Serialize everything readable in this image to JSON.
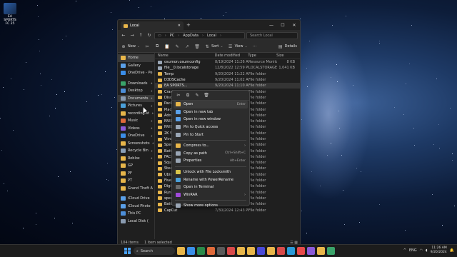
{
  "desktop": {
    "icon_label": "EA SPORTS FC 25"
  },
  "window": {
    "tab_title": "Local",
    "close_tab": "✕",
    "new_tab": "+",
    "controls": {
      "minimize": "—",
      "maximize": "☐",
      "close": "✕"
    },
    "nav": {
      "back": "←",
      "forward": "→",
      "up": "↑",
      "refresh": "↻"
    },
    "breadcrumb": [
      "PC",
      "AppData",
      "Local"
    ],
    "search_placeholder": "Search Local",
    "toolbar": {
      "new_label": "New",
      "sort_label": "Sort",
      "view_label": "View",
      "more": "···",
      "details_label": "Details"
    },
    "sidebar": [
      {
        "label": "Home",
        "color": "#e8b64a",
        "selected": true
      },
      {
        "label": "Gallery",
        "color": "#5aa0e8"
      },
      {
        "label": "OneDrive - Pe",
        "color": "#3b8ee8"
      },
      {
        "label": "Downloads",
        "color": "#3aa36a",
        "pinned": true,
        "gap": true
      },
      {
        "label": "Desktop",
        "color": "#4c8ed8",
        "pinned": true
      },
      {
        "label": "Documents",
        "color": "#8a9bb0",
        "pinned": true,
        "hover": true
      },
      {
        "label": "Pictures",
        "color": "#4a9fd8",
        "pinned": true
      },
      {
        "label": "recording-st",
        "color": "#e8b64a",
        "pinned": true
      },
      {
        "label": "Music",
        "color": "#e06a3a",
        "pinned": true
      },
      {
        "label": "Videos",
        "color": "#8a5ad8",
        "pinned": true
      },
      {
        "label": "OneDrive",
        "color": "#3b8ee8",
        "pinned": true
      },
      {
        "label": "Screenshots",
        "color": "#e8b64a",
        "pinned": true
      },
      {
        "label": "Recycle Bin",
        "color": "#8aa0b8",
        "pinned": true
      },
      {
        "label": "Roblox",
        "color": "#e8b64a",
        "pinned": true
      },
      {
        "label": "GP",
        "color": "#e8b64a"
      },
      {
        "label": "PF",
        "color": "#e8b64a"
      },
      {
        "label": "PT",
        "color": "#e8b64a"
      },
      {
        "label": "Grand Theft A",
        "color": "#e8b64a"
      },
      {
        "label": "iCloud Drive",
        "color": "#5aa0e8",
        "gap": true
      },
      {
        "label": "iCloud Photo",
        "color": "#5aa0e8"
      },
      {
        "label": "This PC",
        "color": "#4c8ed8"
      },
      {
        "label": "Local Disk (",
        "color": "#8a9bb0"
      }
    ],
    "columns": {
      "name": "Name",
      "date": "Date modified",
      "type": "Type",
      "size": "Size"
    },
    "files": [
      {
        "name": "osumon.osumconfig",
        "date": "8/19/2024 11:26 AM",
        "type": "Resource Monitor...",
        "size": "8 KB",
        "color": "#9aa6b5"
      },
      {
        "name": "file__0.localstorage",
        "date": "12/8/2022 12:59 PM",
        "type": "LOCALSTORAGE F...",
        "size": "1,041 KB",
        "color": "#9aa6b5"
      },
      {
        "name": "Temp",
        "date": "9/20/2024 11:22 AM",
        "type": "File folder",
        "size": "",
        "color": "#e8b64a"
      },
      {
        "name": "D3DSCache",
        "date": "9/20/2024 11:02 AM",
        "type": "File folder",
        "size": "",
        "color": "#e8b64a"
      },
      {
        "name": "EA SPORTS...",
        "date": "9/20/2024 11:10 AM",
        "type": "File folder",
        "size": "",
        "color": "#e8b64a",
        "selected": true
      },
      {
        "name": "CrashDu",
        "date": "",
        "type": "File folder",
        "size": "",
        "color": "#e8b64a"
      },
      {
        "name": "Discord",
        "date": "",
        "type": "File folder",
        "size": "",
        "color": "#e8b64a"
      },
      {
        "name": "Package",
        "date": "",
        "type": "File folder",
        "size": "",
        "color": "#e8b64a"
      },
      {
        "name": "PlaceHo",
        "date": "",
        "type": "File folder",
        "size": "",
        "color": "#e8b64a"
      },
      {
        "name": "Adobe",
        "date": "",
        "type": "File folder",
        "size": "",
        "color": "#e8b64a"
      },
      {
        "name": "NVIDIA",
        "date": "",
        "type": "File folder",
        "size": "",
        "color": "#e8b64a"
      },
      {
        "name": "NVIDIA",
        "date": "",
        "type": "File folder",
        "size": "",
        "color": "#e8b64a"
      },
      {
        "name": "2K Sport",
        "date": "",
        "type": "File folder",
        "size": "",
        "color": "#e8b64a"
      },
      {
        "name": "Vivox",
        "date": "",
        "type": "File folder",
        "size": "",
        "color": "#e8b64a"
      },
      {
        "name": "Spectre",
        "date": "",
        "type": "File folder",
        "size": "",
        "color": "#e8b64a"
      },
      {
        "name": "BattlEye",
        "date": "",
        "type": "File folder",
        "size": "",
        "color": "#e8b64a"
      },
      {
        "name": "FACEIT",
        "date": "",
        "type": "File folder",
        "size": "",
        "color": "#e8b64a"
      },
      {
        "name": "Squirrel",
        "date": "",
        "type": "File folder",
        "size": "",
        "color": "#e8b64a"
      },
      {
        "name": "Steam",
        "date": "",
        "type": "File folder",
        "size": "",
        "color": "#e8b64a"
      },
      {
        "name": "Ubisoft",
        "date": "",
        "type": "File folder",
        "size": "",
        "color": "#e8b64a"
      },
      {
        "name": "FiveM",
        "date": "",
        "type": "File folder",
        "size": "",
        "color": "#e8b64a"
      },
      {
        "name": "DigitalZ",
        "date": "",
        "type": "File folder",
        "size": "",
        "color": "#e8b64a"
      },
      {
        "name": "RuneLite",
        "date": "9/11/2024 1:58 AM",
        "type": "File folder",
        "size": "",
        "color": "#e8b64a"
      },
      {
        "name": "speech",
        "date": "8/1/2024 8:07 PM",
        "type": "File folder",
        "size": "",
        "color": "#e8b64a"
      },
      {
        "name": "Battle.net",
        "date": "7/30/2024 12:51 PM",
        "type": "File folder",
        "size": "",
        "color": "#e8b64a"
      },
      {
        "name": "CapCut",
        "date": "7/30/2024 12:43 PM",
        "type": "File folder",
        "size": "",
        "color": "#e8b64a"
      }
    ],
    "status": {
      "items": "104 items",
      "selected": "1 item selected"
    }
  },
  "context_menu": {
    "quick_actions": [
      "cut-icon",
      "copy-icon",
      "rename-icon",
      "delete-icon"
    ],
    "quick_glyphs": [
      "✂",
      "⧉",
      "✎",
      "🗑"
    ],
    "items": [
      {
        "label": "Open",
        "shortcut": "Enter",
        "color": "#e8b64a",
        "active": true
      },
      {
        "label": "Open in new tab",
        "shortcut": "",
        "color": "#5aa0e8"
      },
      {
        "label": "Open in new window",
        "shortcut": "",
        "color": "#5aa0e8"
      },
      {
        "label": "Pin to Quick access",
        "shortcut": "",
        "color": "#9aa6b5"
      },
      {
        "label": "Pin to Start",
        "shortcut": "",
        "color": "#9aa6b5"
      },
      {
        "label": "Compress to...",
        "shortcut": "",
        "color": "#e8b64a",
        "submenu": true,
        "sep_before": true
      },
      {
        "label": "Copy as path",
        "shortcut": "Ctrl+Shift+C",
        "color": "#9aa6b5"
      },
      {
        "label": "Properties",
        "shortcut": "Alt+Enter",
        "color": "#9aa6b5"
      },
      {
        "label": "Unlock with File Locksmith",
        "shortcut": "",
        "color": "#d8c44a",
        "sep_before": true
      },
      {
        "label": "Rename with PowerRename",
        "shortcut": "",
        "color": "#4a9fd8"
      },
      {
        "label": "Open in Terminal",
        "shortcut": "",
        "color": "#6a6a6a"
      },
      {
        "label": "WinRAR",
        "shortcut": "",
        "color": "#a04ad8",
        "submenu": true
      },
      {
        "label": "Show more options",
        "shortcut": "",
        "color": "#9aa6b5",
        "sep_before": true
      }
    ]
  },
  "taskbar": {
    "search_label": "Search",
    "apps": [
      "#e8b64a",
      "#3b8ee8",
      "#2a8a4a",
      "#e06a3a",
      "#5a5a5a",
      "#d84a4a",
      "#e8b64a",
      "#e8b64a",
      "#4a4ad8",
      "#e8b64a",
      "#d84a4a",
      "#2a9ad8",
      "#e84a4a",
      "#8a5ad8",
      "#e8b64a",
      "#3aa36a"
    ],
    "tray_lang": "ENG",
    "time": "11:26 AM",
    "date": "9/20/2024"
  }
}
